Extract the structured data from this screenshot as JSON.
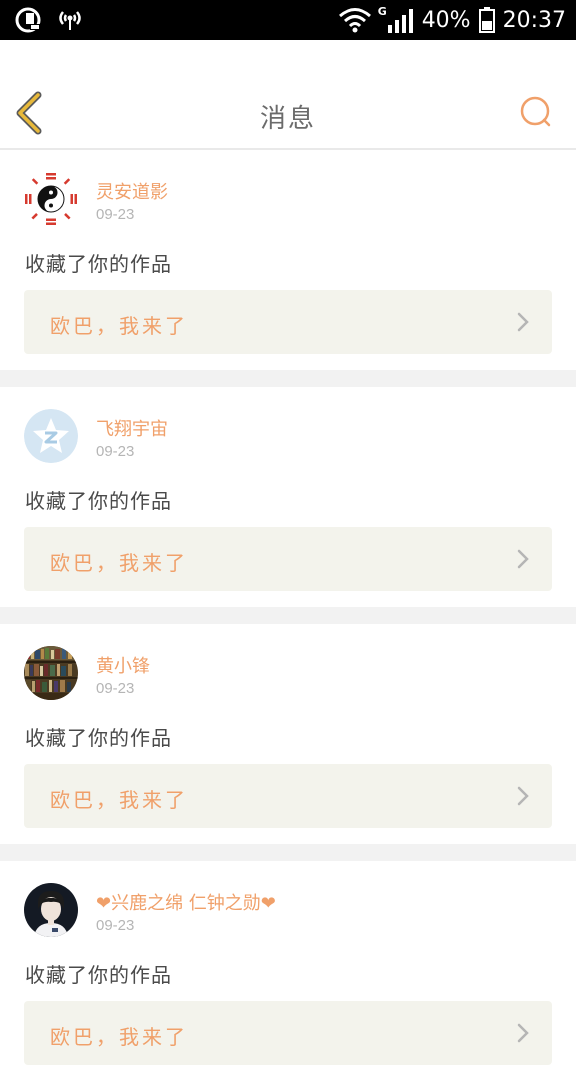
{
  "status_bar": {
    "network": "G",
    "battery": "40%",
    "time": "20:37"
  },
  "header": {
    "title": "消息",
    "back_icon": "chevron-left-icon",
    "search_icon": "search-icon"
  },
  "colors": {
    "accent": "#f0a06a",
    "back_arrow": "#e8b93a",
    "separator": "#f2f2f2",
    "work_box_bg": "#f3f3ec"
  },
  "notifications": [
    {
      "username": "灵安道影",
      "date": "09-23",
      "action": "收藏了你的作品",
      "work_title": "欧巴，我来了",
      "avatar": "yin-yang-bagua-avatar"
    },
    {
      "username": "飞翔宇宙",
      "date": "09-23",
      "action": "收藏了你的作品",
      "work_title": "欧巴，我来了",
      "avatar": "qzone-star-avatar"
    },
    {
      "username": "黄小锋",
      "date": "09-23",
      "action": "收藏了你的作品",
      "work_title": "欧巴，我来了",
      "avatar": "bookshelf-photo-avatar"
    },
    {
      "username": "❤兴鹿之绵 仁钟之勋❤",
      "date": "09-23",
      "action": "收藏了你的作品",
      "work_title": "欧巴，我来了",
      "avatar": "person-photo-avatar"
    }
  ]
}
